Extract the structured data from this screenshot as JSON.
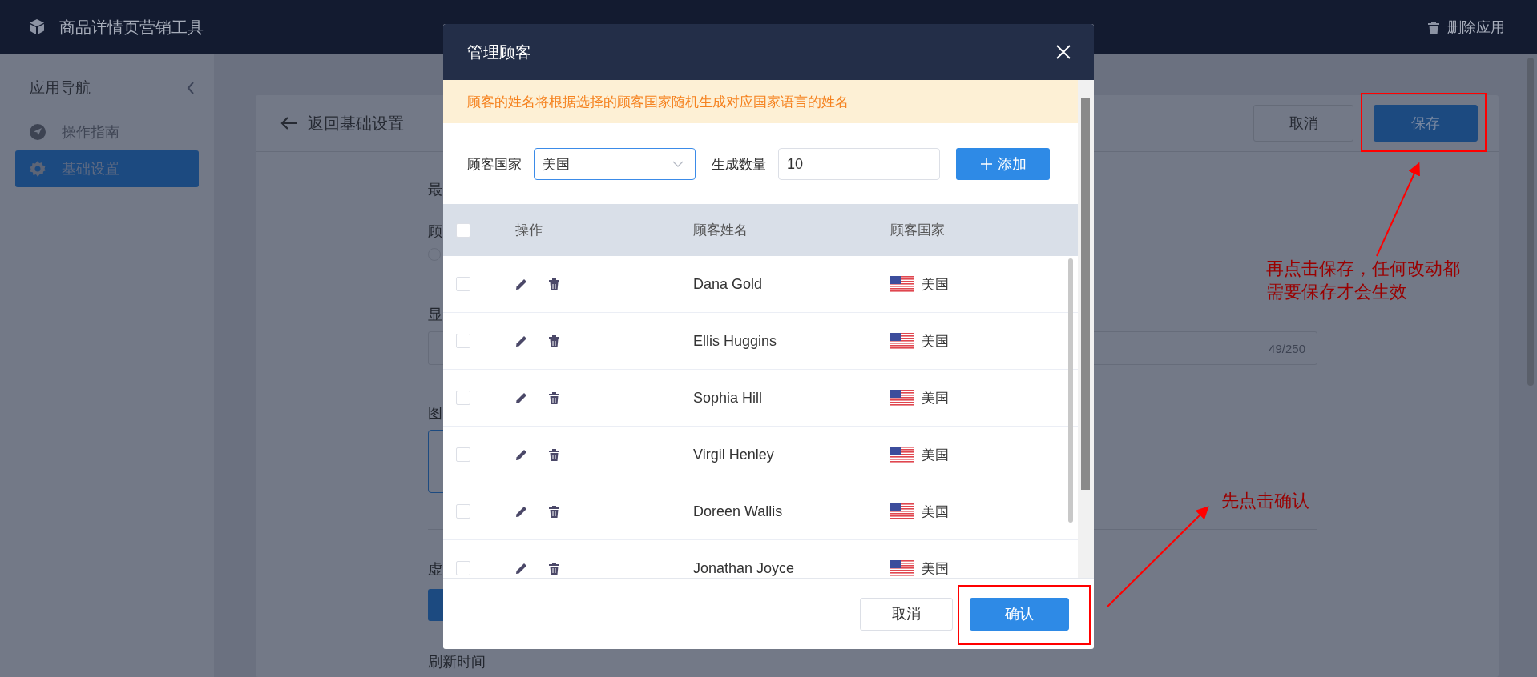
{
  "app_bar": {
    "title": "商品详情页营销工具",
    "delete_action": "删除应用"
  },
  "sidebar": {
    "title": "应用导航",
    "items": [
      {
        "label": "操作指南",
        "kind": "guide",
        "selected": false
      },
      {
        "label": "基础设置",
        "kind": "settings",
        "selected": true
      }
    ]
  },
  "page": {
    "back_label": "返回基础设置",
    "buttons": [
      {
        "label": "取消",
        "kind": "secondary"
      },
      {
        "label": "保存",
        "kind": "primary"
      }
    ],
    "form_fragments": [
      {
        "kind": "label",
        "text": "最"
      },
      {
        "kind": "label",
        "text": "顾"
      },
      {
        "kind": "radio",
        "selected": false
      },
      {
        "kind": "label",
        "text": "显"
      },
      {
        "kind": "input",
        "counter": "49/250"
      },
      {
        "kind": "label",
        "text": "图"
      },
      {
        "kind": "textarea"
      },
      {
        "kind": "divider"
      },
      {
        "kind": "label",
        "text": "虚"
      },
      {
        "kind": "button"
      },
      {
        "kind": "label",
        "text": "刷新时间"
      }
    ]
  },
  "dialog": {
    "title": "管理顾客",
    "notice": "顾客的姓名将根据选择的顾客国家随机生成对应国家语言的姓名",
    "country_field": {
      "label": "顾客国家",
      "value": "美国"
    },
    "count_field": {
      "label": "生成数量",
      "value": "10"
    },
    "add_button": "添加",
    "table": {
      "select_all_checked": false,
      "columns": [
        "操作",
        "顾客姓名",
        "顾客国家"
      ],
      "rows": [
        {
          "checked": false,
          "name": "Dana Gold",
          "country": "美国"
        },
        {
          "checked": false,
          "name": "Ellis Huggins",
          "country": "美国"
        },
        {
          "checked": false,
          "name": "Sophia Hill",
          "country": "美国"
        },
        {
          "checked": false,
          "name": "Virgil Henley",
          "country": "美国"
        },
        {
          "checked": false,
          "name": "Doreen Wallis",
          "country": "美国"
        },
        {
          "checked": false,
          "name": "Jonathan Joyce",
          "country": "美国"
        }
      ]
    },
    "buttons": [
      {
        "label": "取消",
        "kind": "secondary"
      },
      {
        "label": "确认",
        "kind": "primary"
      }
    ]
  },
  "annotations": [
    {
      "kind": "save",
      "lines": [
        "再点击保存，任何改动都",
        "需要保存才会生效"
      ]
    },
    {
      "kind": "confirm",
      "lines": [
        "先点击确认"
      ]
    }
  ]
}
